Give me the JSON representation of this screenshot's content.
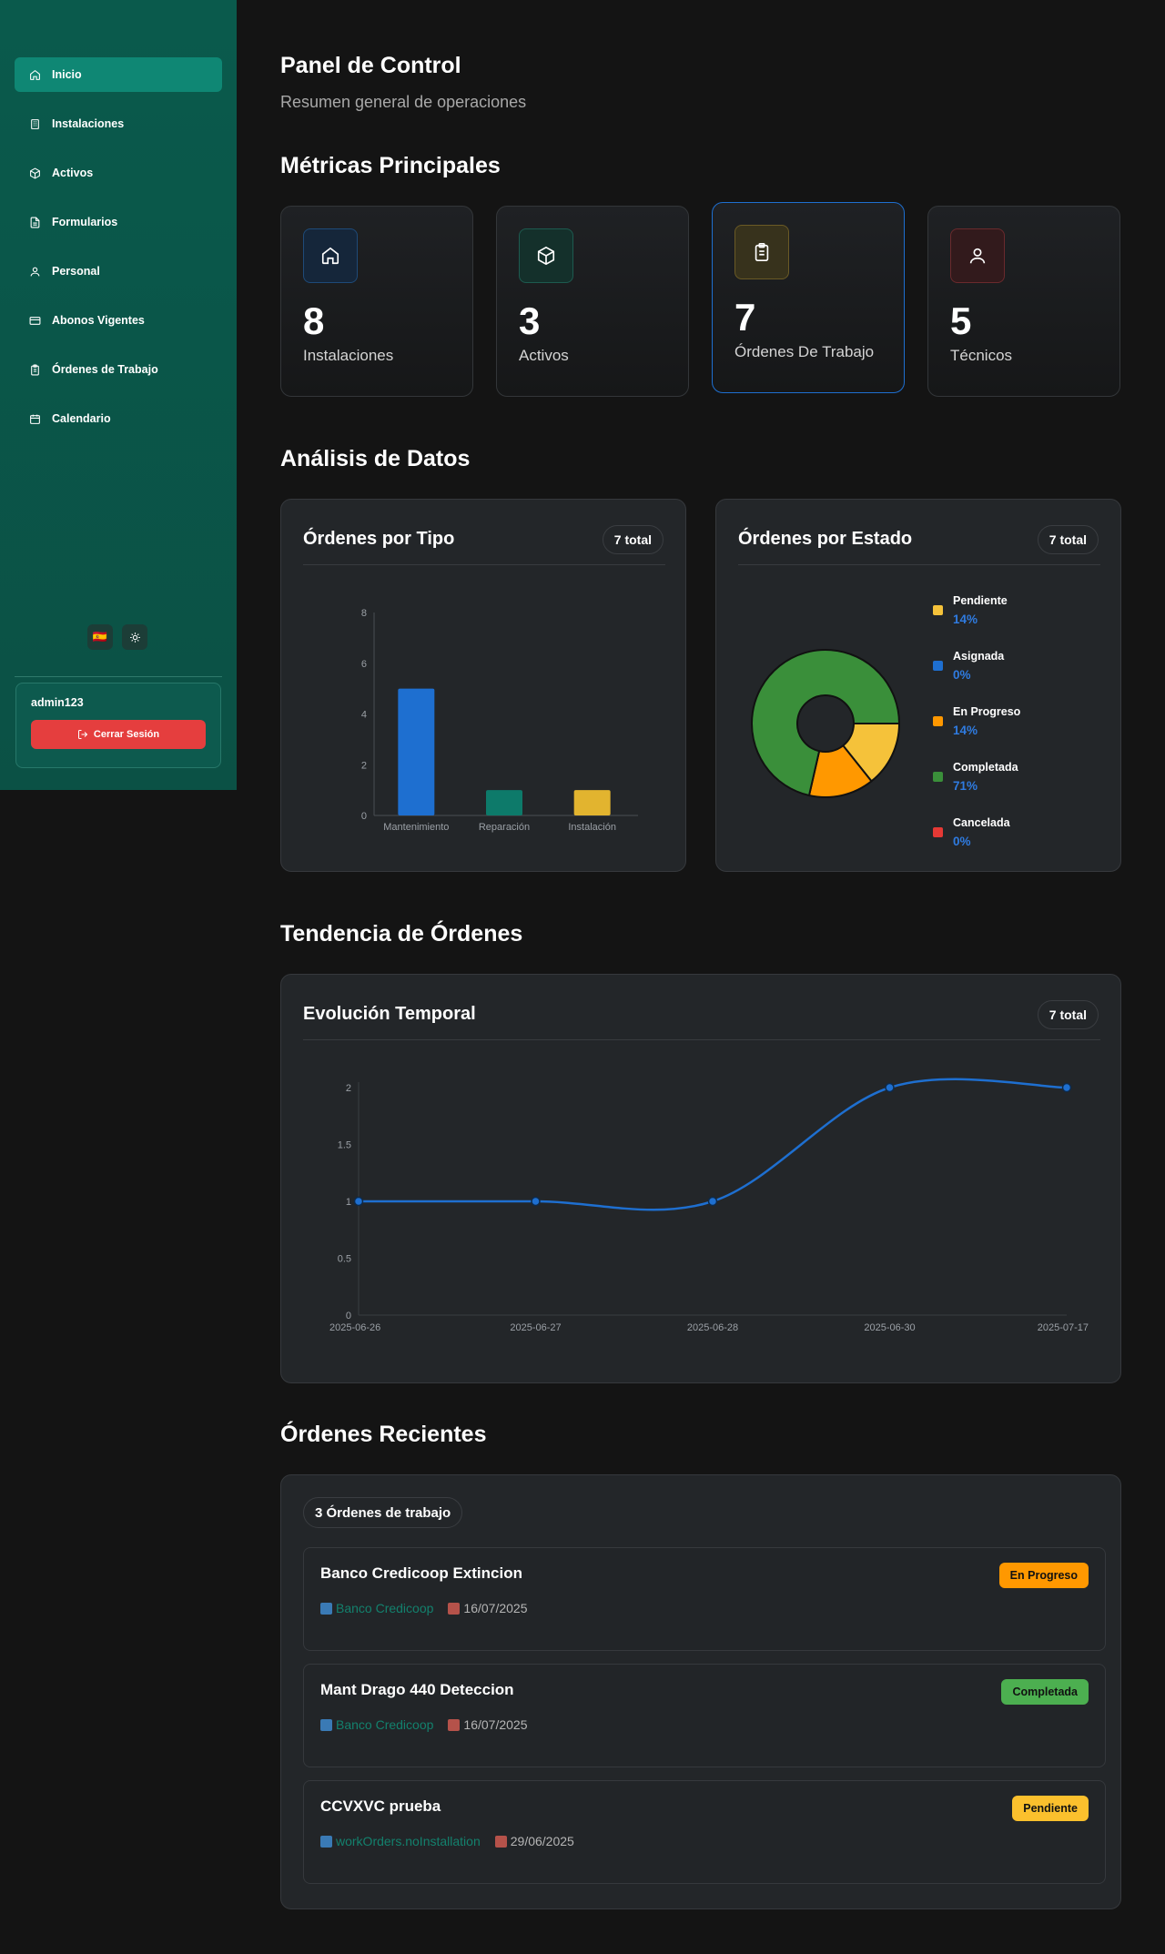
{
  "sidebar": {
    "items": [
      {
        "label": "Inicio",
        "icon": "home-icon",
        "active": true
      },
      {
        "label": "Instalaciones",
        "icon": "building-icon"
      },
      {
        "label": "Activos",
        "icon": "box-icon"
      },
      {
        "label": "Formularios",
        "icon": "file-icon"
      },
      {
        "label": "Personal",
        "icon": "user-icon"
      },
      {
        "label": "Abonos Vigentes",
        "icon": "card-icon"
      },
      {
        "label": "Órdenes de Trabajo",
        "icon": "clipboard-icon"
      },
      {
        "label": "Calendario",
        "icon": "calendar-icon"
      }
    ],
    "language_flag": "🇪🇸",
    "user": {
      "name": "admin123",
      "logout_label": "Cerrar Sesión"
    }
  },
  "header": {
    "title": "Panel de Control",
    "subtitle": "Resumen general de operaciones"
  },
  "sections": {
    "metrics": "Métricas Principales",
    "analysis": "Análisis de Datos",
    "trend": "Tendencia de Órdenes",
    "recent": "Órdenes Recientes"
  },
  "metrics": [
    {
      "value": "8",
      "label": "Instalaciones",
      "icon": "home-icon",
      "color": "#1e6fd0"
    },
    {
      "value": "3",
      "label": "Activos",
      "icon": "box-icon",
      "color": "#13816d"
    },
    {
      "value": "7",
      "label": "Órdenes De Trabajo",
      "icon": "clipboard-icon",
      "color": "#c9a227"
    },
    {
      "value": "5",
      "label": "Técnicos",
      "icon": "user-icon",
      "color": "#d13a3a"
    }
  ],
  "charts": {
    "type_title": "Órdenes por Tipo",
    "type_total": "7 total",
    "state_title": "Órdenes por Estado",
    "state_total": "7 total",
    "trend_title": "Evolución Temporal",
    "trend_total": "7 total"
  },
  "chart_data": [
    {
      "type": "bar",
      "title": "Órdenes por Tipo",
      "categories": [
        "Mantenimiento",
        "Reparación",
        "Instalación"
      ],
      "values": [
        5,
        1,
        1
      ],
      "colors": [
        "#1e6fd0",
        "#0d7a6a",
        "#e2b42f"
      ],
      "yticks": [
        "0",
        "2",
        "4",
        "6",
        "8"
      ],
      "ylim": [
        0,
        8
      ],
      "grid": false
    },
    {
      "type": "pie",
      "title": "Órdenes por Estado",
      "donut": true,
      "slices": [
        {
          "name": "Pendiente",
          "value": 1,
          "pct": "14%",
          "color": "#f5c23a"
        },
        {
          "name": "Asignada",
          "value": 0,
          "pct": "0%",
          "color": "#1e6fd0"
        },
        {
          "name": "En Progreso",
          "value": 1,
          "pct": "14%",
          "color": "#ff9800"
        },
        {
          "name": "Completada",
          "value": 5,
          "pct": "71%",
          "color": "#3a8f3a"
        },
        {
          "name": "Cancelada",
          "value": 0,
          "pct": "0%",
          "color": "#e53935"
        }
      ],
      "legend": "right"
    },
    {
      "type": "line",
      "title": "Evolución Temporal",
      "x": [
        "2025-06-26",
        "2025-06-27",
        "2025-06-28",
        "2025-06-30",
        "2025-07-17"
      ],
      "values": [
        1,
        1,
        1,
        2,
        2
      ],
      "yticks": [
        "0",
        "0.5",
        "1",
        "1.5",
        "2"
      ],
      "ylim": [
        0,
        2
      ],
      "color": "#1e6fd0",
      "grid": false
    }
  ],
  "recent": {
    "count_label": "3 Órdenes de trabajo",
    "orders": [
      {
        "title": "Banco Credicoop Extincion",
        "location": "Banco Credicoop",
        "date": "16/07/2025",
        "status": "En Progreso",
        "status_color": "#ff9800"
      },
      {
        "title": "Mant Drago 440 Deteccion",
        "location": "Banco Credicoop",
        "date": "16/07/2025",
        "status": "Completada",
        "status_color": "#4caf50"
      },
      {
        "title": "CCVXVC prueba",
        "location": "workOrders.noInstallation",
        "date": "29/06/2025",
        "status": "Pendiente",
        "status_color": "#fbc02d"
      }
    ]
  }
}
